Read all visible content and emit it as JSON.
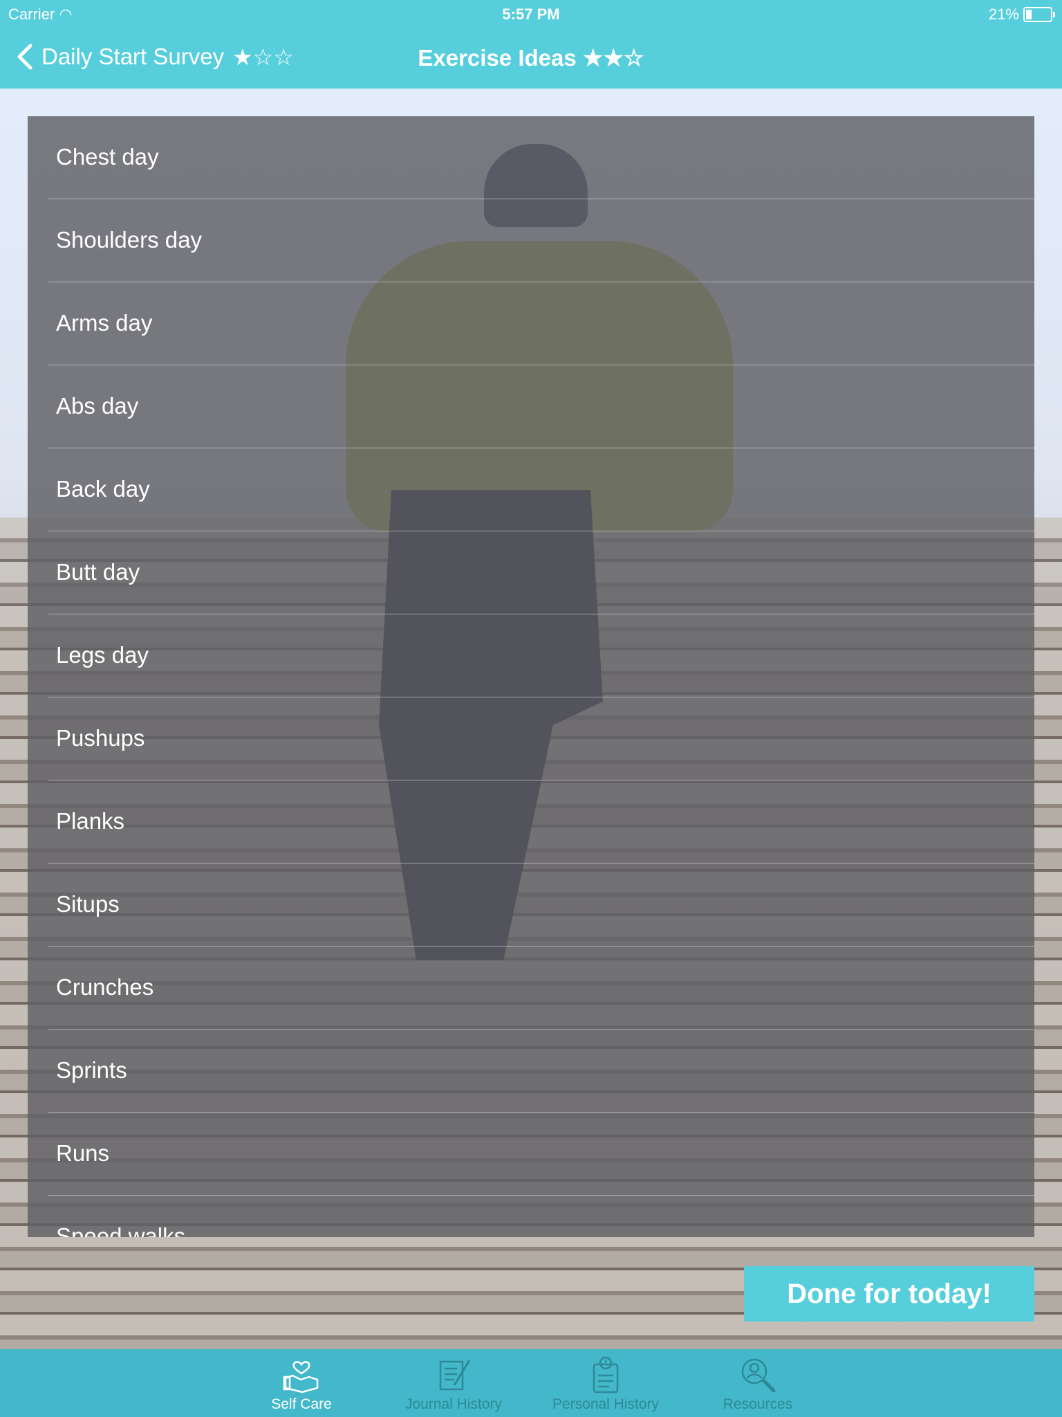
{
  "status_bar": {
    "carrier": "Carrier",
    "time": "5:57 PM",
    "battery": "21%"
  },
  "nav": {
    "back_label": "Daily Start Survey",
    "back_stars": "★☆☆",
    "title": "Exercise Ideas",
    "title_stars": "★★☆"
  },
  "exercises": [
    "Chest day",
    "Shoulders day",
    "Arms day",
    "Abs day",
    "Back day",
    "Butt day",
    "Legs day",
    "Pushups",
    "Planks",
    "Situps",
    "Crunches",
    "Sprints",
    "Runs",
    "Speed walks"
  ],
  "done_button": "Done for today!",
  "tabs": [
    {
      "label": "Self Care",
      "icon": "hands-heart-icon",
      "active": true
    },
    {
      "label": "Journal History",
      "icon": "journal-icon",
      "active": false
    },
    {
      "label": "Personal History",
      "icon": "clipboard-clock-icon",
      "active": false
    },
    {
      "label": "Resources",
      "icon": "person-search-icon",
      "active": false
    }
  ],
  "colors": {
    "accent": "#56cedc",
    "tabbar": "#42b8ca",
    "inactive_tab": "#2f8896"
  }
}
